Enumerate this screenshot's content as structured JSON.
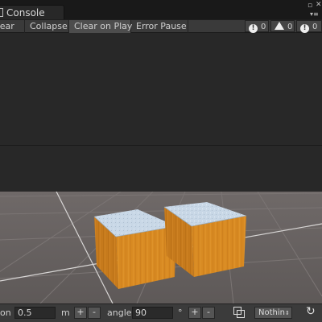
{
  "window": {
    "tab_title": "Console",
    "icons": [
      "panel-menu-icon",
      "maximize-icon",
      "close-icon"
    ]
  },
  "toolbar": {
    "buttons": [
      {
        "label": "Clear",
        "active": false
      },
      {
        "label": "Collapse",
        "active": false
      },
      {
        "label": "Clear on Play",
        "active": true
      },
      {
        "label": "Error Pause",
        "active": false
      }
    ],
    "counters": [
      {
        "icon": "info-icon",
        "count": "0"
      },
      {
        "icon": "warning-icon",
        "count": "0"
      },
      {
        "icon": "error-icon",
        "count": "0"
      }
    ]
  },
  "scene": {
    "objects": [
      "cube",
      "cube"
    ],
    "colors": {
      "cube_side": "#d88a22",
      "cube_top": "#c8d7e6",
      "ground": "#6a6462"
    }
  },
  "snap_bar": {
    "position_label_tail": "on",
    "position_value": "0.5",
    "position_unit": "m",
    "angle_label": "angle",
    "angle_value": "90",
    "angle_unit": "°",
    "plus_label": "+",
    "minus_label": "-",
    "layer_dropdown": "Nothin",
    "icons": [
      "snap-pivot-icon",
      "refresh-icon"
    ]
  },
  "colors": {
    "window_bg": "#282828",
    "toolbar_bg": "#3a3a3a",
    "text": "#cfcfcf"
  }
}
